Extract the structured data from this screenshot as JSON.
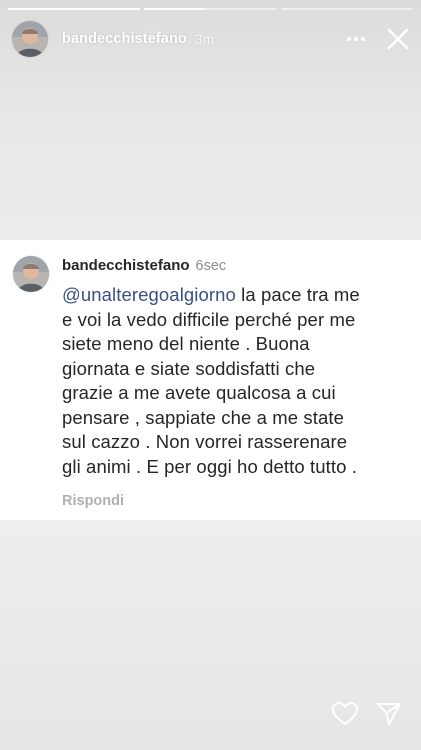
{
  "story": {
    "progress": [
      1.0,
      0.45,
      0.0
    ],
    "username": "bandecchistefano",
    "time": "3m",
    "icons": {
      "more": "more-horizontal-icon",
      "close": "close-icon",
      "like": "heart-icon",
      "share": "send-icon"
    }
  },
  "comment": {
    "username": "bandecchistefano",
    "time": "6sec",
    "mention": "@unalteregoalgiorno",
    "text_lines": [
      " la pace tra me",
      "e voi la vedo difficile perché per me",
      "siete meno del niente . Buona",
      "giornata e siate soddisfatti che",
      "grazie a me avete qualcosa a cui",
      "pensare , sappiate che a me state",
      "sul cazzo . Non vorrei rasserenare",
      "gli animi . E per oggi ho detto tutto ."
    ],
    "reply_label": "Rispondi"
  },
  "colors": {
    "background": "#e8e8e8",
    "card": "#ffffff",
    "mention": "#385185",
    "muted": "#8e8e8e"
  }
}
